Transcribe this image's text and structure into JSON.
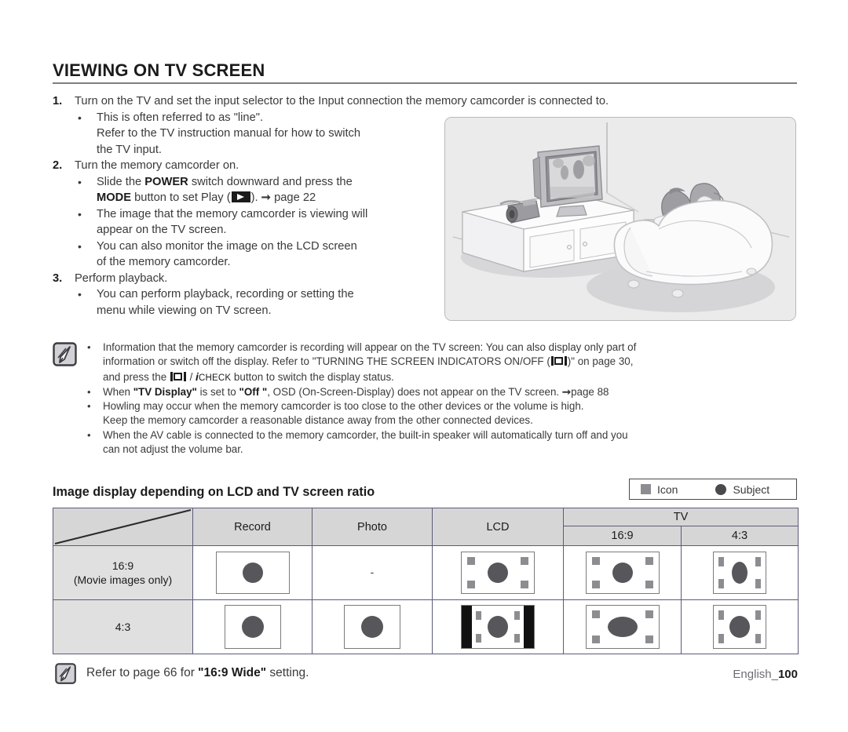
{
  "heading": {
    "title": "VIEWING ON TV SCREEN"
  },
  "steps": [
    {
      "number": "1.",
      "text": "Turn on the TV and set the input selector to the Input connection the memory camcorder is connected to.",
      "bullets": [
        {
          "line1": "This is often referred to as \"line\".",
          "line2": "Refer to the TV instruction manual for how to switch",
          "line3": "the TV input."
        }
      ]
    },
    {
      "number": "2.",
      "text": "Turn the memory camcorder on.",
      "bullets": [
        {
          "pre": "Slide the ",
          "bold1": "POWER",
          "mid": " switch downward and press the",
          "bold2": "MODE",
          "post": " button to set Play (",
          "after_icon": "). ",
          "ref": "page 22"
        },
        {
          "line1": "The image that the memory camcorder is viewing will",
          "line2": "appear on the TV screen."
        },
        {
          "line1": "You can also monitor the image on the LCD screen",
          "line2": "of the memory camcorder."
        }
      ]
    },
    {
      "number": "3.",
      "text": "Perform playback.",
      "bullets": [
        {
          "line1": "You can perform playback, recording or setting the",
          "line2": "menu while viewing on TV screen."
        }
      ]
    }
  ],
  "notes": [
    {
      "l1a": "Information that the memory camcorder is recording will appear on the TV screen: You can also display only part of",
      "l2a": "information or switch off the display. Refer to \"TURNING THE SCREEN INDICATORS ON/OFF (",
      "l2b": ")\" on page 30,",
      "l3a": "and press the ",
      "l3b": " / ",
      "l3c": "i",
      "l3d": "CHECK",
      "l3e": " button to switch the display status."
    },
    {
      "p1": "When ",
      "b1": "\"TV Display\"",
      "p2": " is set to ",
      "b2": "\"Off \"",
      "p3": ", OSD (On-Screen-Display) does not appear on the TV screen. ",
      "ref": "page 88"
    },
    {
      "l1": "Howling may occur when the memory camcorder is too close to the other devices or the volume is high.",
      "l2": "Keep the memory camcorder a reasonable distance away from the other connected devices."
    },
    {
      "l1": "When the AV cable is connected to the memory camcorder, the built-in speaker will automatically turn off and you",
      "l2": "can not adjust the volume bar."
    }
  ],
  "table_section": {
    "caption": "Image display depending on LCD and TV screen ratio",
    "legend": {
      "icon_label": "Icon",
      "subject_label": "Subject"
    },
    "headers": {
      "corner": "",
      "record": "Record",
      "photo": "Photo",
      "lcd": "LCD",
      "tv": "TV",
      "tv_169": "16:9",
      "tv_43": "4:3"
    },
    "rows": [
      {
        "label_line1": "16:9",
        "label_line2": "(Movie images only)",
        "record": "box-wide",
        "photo": "-",
        "lcd": "box-wide-icons",
        "tv_169": "box-wide-icons",
        "tv_43": "box-narrow-icons"
      },
      {
        "label_line1": "4:3",
        "label_line2": "",
        "record": "box-standard",
        "photo": "box-standard",
        "lcd": "box-letterbox",
        "tv_169": "box-wide-stretched",
        "tv_43": "box-standard-icons"
      }
    ]
  },
  "footer": {
    "note_pre": "Refer to page 66 for ",
    "note_bold": "\"16:9 Wide\"",
    "note_post": " setting.",
    "page_label": "English_",
    "page_number": "100"
  },
  "colors": {
    "text": "#3a3a3c",
    "heading": "#1b1b1b",
    "rule": "#7d7d85",
    "table_header_bg": "#d6d6d6",
    "table_rowlabel_bg": "#e0e0e0",
    "table_border": "#5b5b7a",
    "subject": "#57575b",
    "icon_marker": "#8d8d91"
  }
}
